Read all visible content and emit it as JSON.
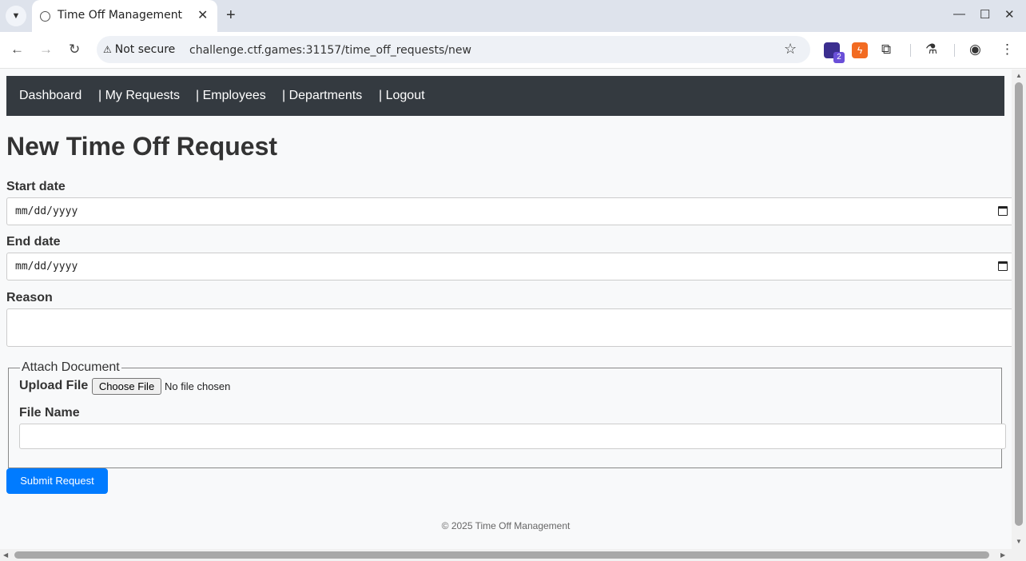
{
  "browser": {
    "tab_title": "Time Off Management",
    "security_label": "Not secure",
    "url": "challenge.ctf.games:31157/time_off_requests/new",
    "extension_badge": "2",
    "accent_colors": {
      "ext_purple": "#3b2e8f",
      "ext_orange": "#f26b22"
    }
  },
  "nav": {
    "links": [
      "Dashboard",
      "| My Requests",
      "| Employees",
      "| Departments",
      "| Logout"
    ]
  },
  "form": {
    "title": "New Time Off Request",
    "start_date_label": "Start date",
    "start_date_placeholder": "mm/dd/yyyy",
    "end_date_label": "End date",
    "end_date_placeholder": "mm/dd/yyyy",
    "reason_label": "Reason",
    "attach_legend": "Attach Document",
    "upload_label": "Upload File",
    "choose_file_label": "Choose File",
    "no_file_text": "No file chosen",
    "file_name_label": "File Name",
    "submit_label": "Submit Request"
  },
  "footer": {
    "text": "© 2025 Time Off Management"
  },
  "colors": {
    "navbar_bg": "#343a40",
    "primary": "#007bff",
    "page_bg": "#f8f9fa"
  }
}
